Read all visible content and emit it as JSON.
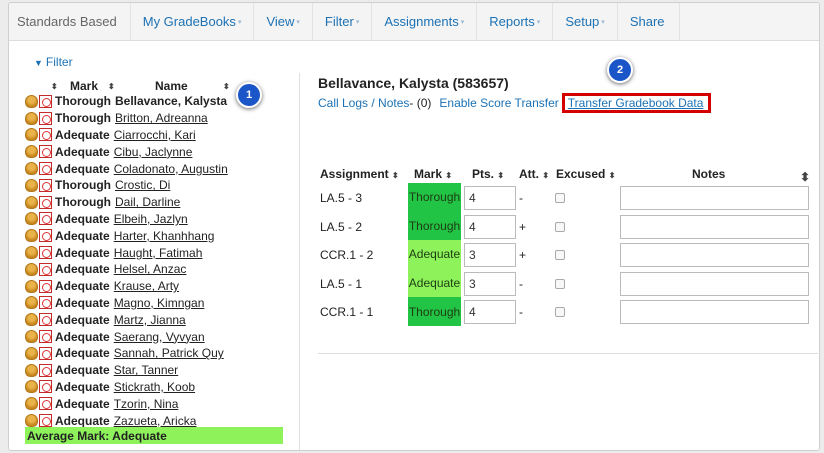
{
  "navbar": {
    "brand": "Standards Based",
    "items": [
      {
        "label": "My GradeBooks",
        "caret": "▾"
      },
      {
        "label": "View",
        "caret": "▾"
      },
      {
        "label": "Filter",
        "caret": "▾"
      },
      {
        "label": "Assignments",
        "caret": "▾"
      },
      {
        "label": "Reports",
        "caret": "▾"
      },
      {
        "label": "Setup",
        "caret": "▾"
      },
      {
        "label": "Share",
        "caret": ""
      }
    ]
  },
  "sidebar": {
    "filter_label": "Filter",
    "col_mark": "Mark",
    "col_name": "Name",
    "sort_glyph": "⬍",
    "students": [
      {
        "mark": "Thorough",
        "name": "Bellavance, Kalysta",
        "selected": true
      },
      {
        "mark": "Thorough",
        "name": "Britton, Adreanna"
      },
      {
        "mark": "Adequate",
        "name": "Ciarrocchi, Kari"
      },
      {
        "mark": "Adequate",
        "name": "Cibu, Jaclynne"
      },
      {
        "mark": "Adequate",
        "name": "Coladonato, Augustin"
      },
      {
        "mark": "Thorough",
        "name": "Crostic, Di"
      },
      {
        "mark": "Thorough",
        "name": "Dail, Darline"
      },
      {
        "mark": "Adequate",
        "name": "Elbeih, Jazlyn"
      },
      {
        "mark": "Adequate",
        "name": "Harter, Khanhhang"
      },
      {
        "mark": "Adequate",
        "name": "Haught, Fatimah"
      },
      {
        "mark": "Adequate",
        "name": "Helsel, Anzac"
      },
      {
        "mark": "Adequate",
        "name": "Krause, Arty"
      },
      {
        "mark": "Adequate",
        "name": "Magno, Kimngan"
      },
      {
        "mark": "Adequate",
        "name": "Martz, Jianna"
      },
      {
        "mark": "Adequate",
        "name": "Saerang, Vyvyan"
      },
      {
        "mark": "Adequate",
        "name": "Sannah, Patrick Quy"
      },
      {
        "mark": "Adequate",
        "name": "Star, Tanner"
      },
      {
        "mark": "Adequate",
        "name": "Stickrath, Koob"
      },
      {
        "mark": "Adequate",
        "name": "Tzorin, Nina"
      },
      {
        "mark": "Adequate",
        "name": "Zazueta, Aricka"
      }
    ],
    "average_label": "Average Mark: Adequate"
  },
  "detail": {
    "student_title": "Bellavance, Kalysta (583657)",
    "call_logs": "Call Logs / Notes",
    "call_logs_count": " - (0)",
    "enable_score_transfer": "Enable Score Transfer",
    "transfer_gradebook_data": "Transfer Gradebook Data",
    "columns": {
      "assignment": "Assignment",
      "mark": "Mark",
      "pts": "Pts.",
      "att": "Att.",
      "excused": "Excused",
      "notes": "Notes"
    },
    "rows": [
      {
        "assignment": "LA.5 - 3",
        "mark": "Thorough",
        "pts": "4",
        "att": "-",
        "excused": false
      },
      {
        "assignment": "LA.5 - 2",
        "mark": "Thorough",
        "pts": "4",
        "att": "+",
        "excused": false
      },
      {
        "assignment": "CCR.1 - 2",
        "mark": "Adequate",
        "pts": "3",
        "att": "+",
        "excused": false
      },
      {
        "assignment": "LA.5 - 1",
        "mark": "Adequate",
        "pts": "3",
        "att": "-",
        "excused": false
      },
      {
        "assignment": "CCR.1 - 1",
        "mark": "Thorough",
        "pts": "4",
        "att": "-",
        "excused": false
      }
    ]
  },
  "callouts": [
    {
      "number": "1"
    },
    {
      "number": "2"
    }
  ],
  "colors": {
    "thorough": "#22c445",
    "adequate": "#8ef35b",
    "average_bar": "#8ef35b",
    "link": "#1c72b5",
    "highlight_border": "#d40000",
    "callout": "#1a56c8"
  }
}
